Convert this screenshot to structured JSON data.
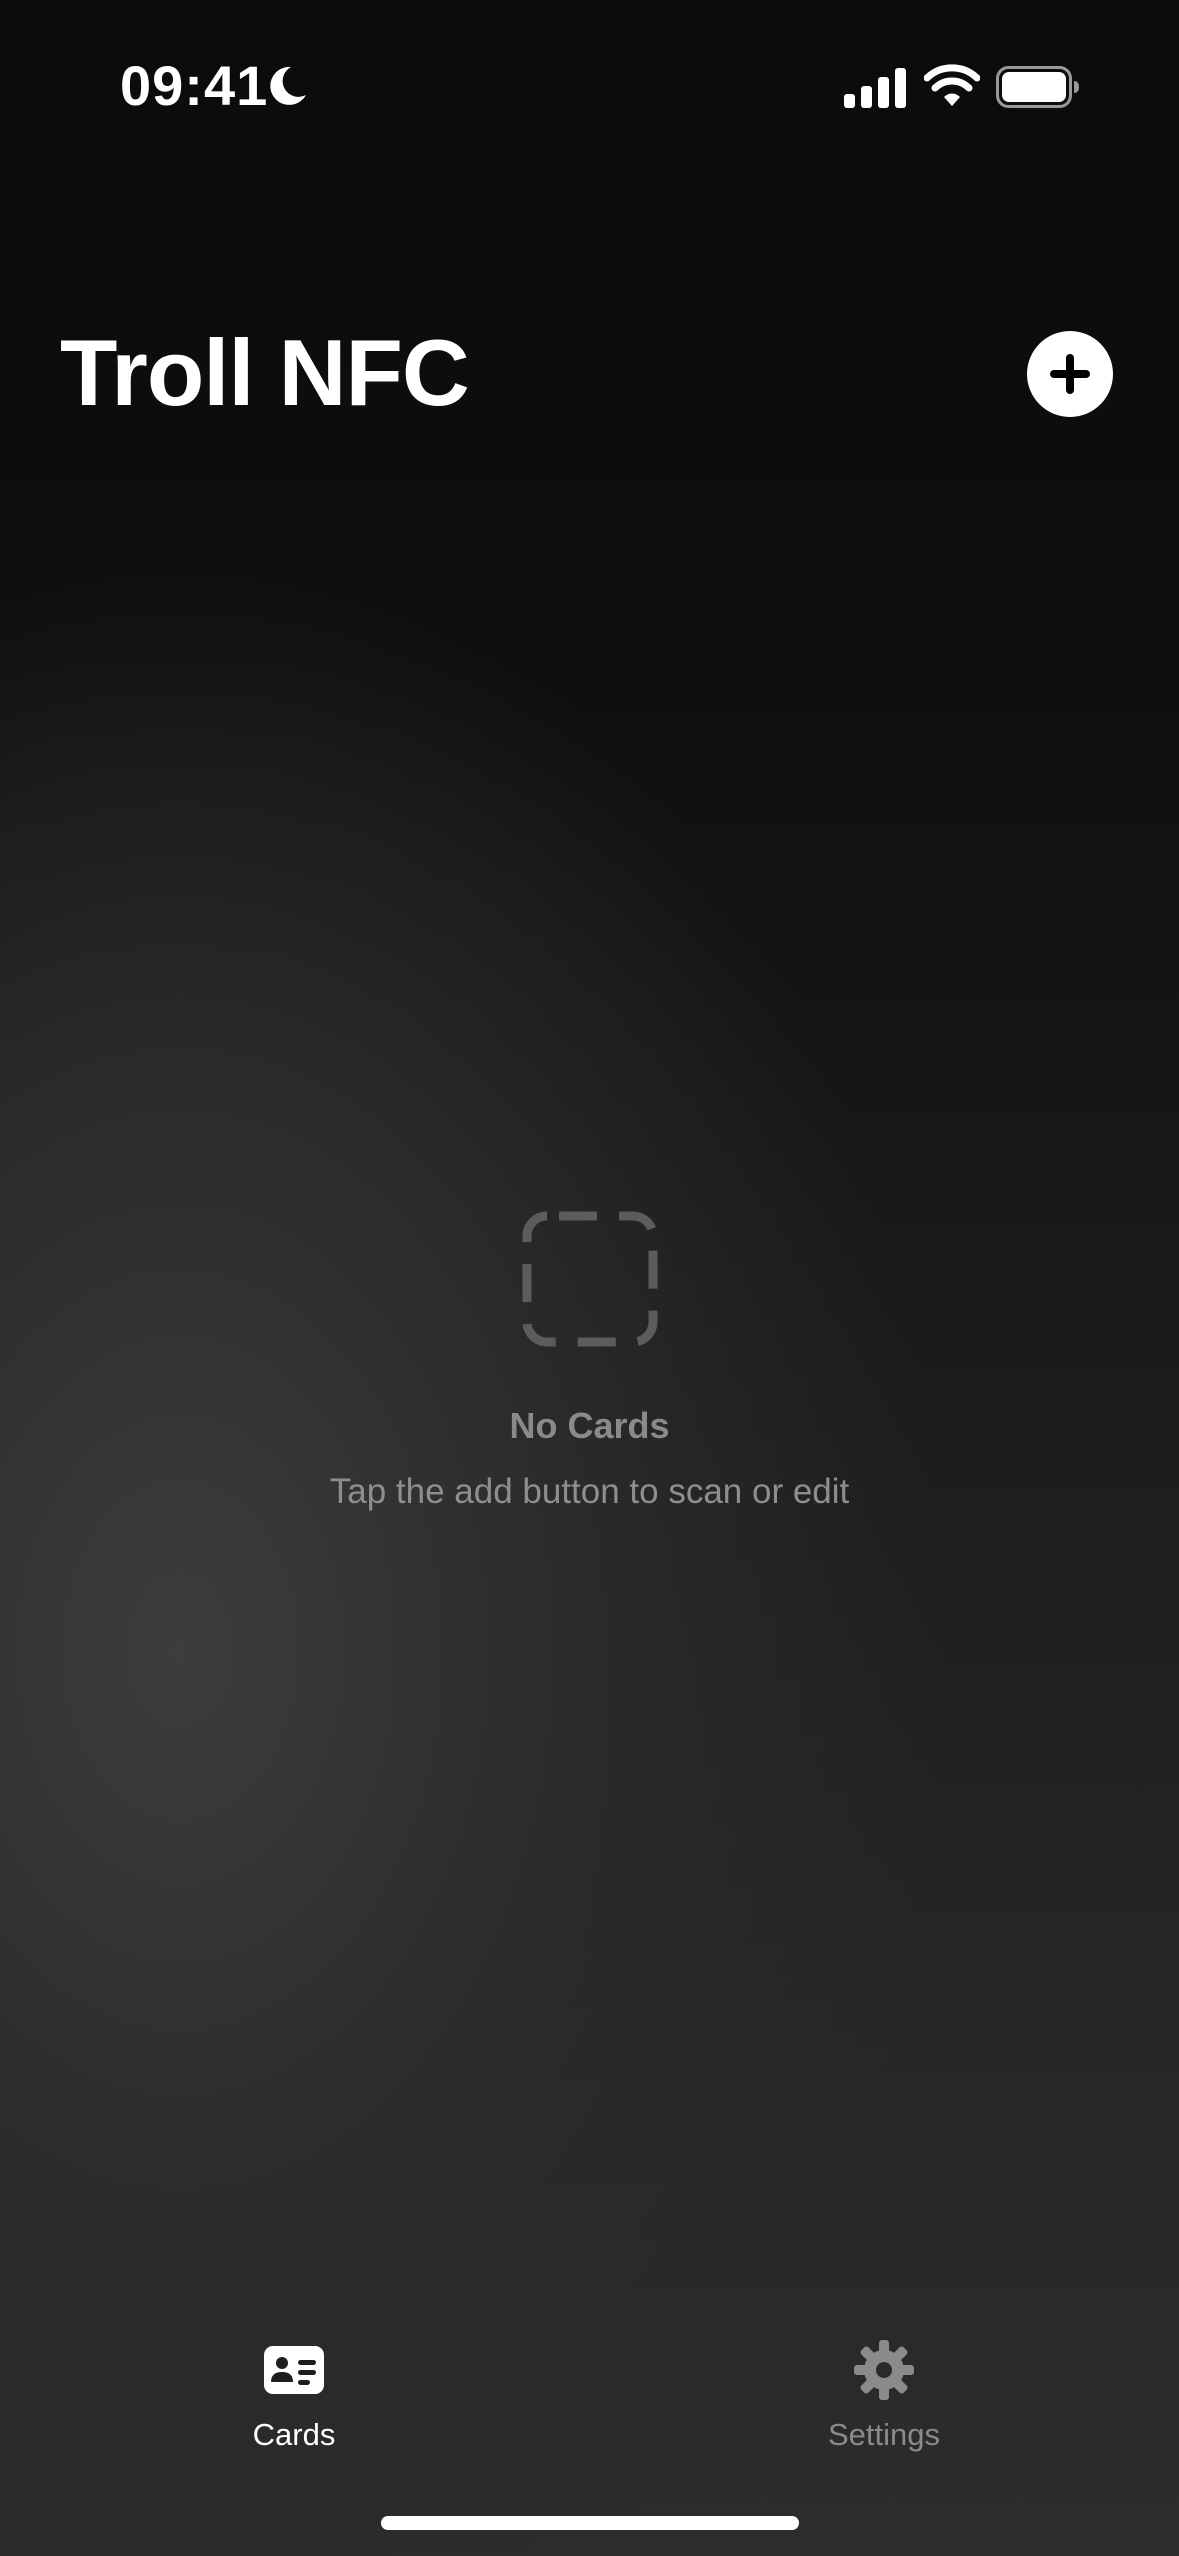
{
  "status_bar": {
    "time": "09:41",
    "icons": [
      "moon-icon",
      "cellular-signal-icon",
      "wifi-icon",
      "battery-icon"
    ]
  },
  "header": {
    "title": "Troll NFC",
    "add_button_icon": "plus-icon"
  },
  "empty_state": {
    "icon": "dashed-square-icon",
    "title": "No Cards",
    "subtitle": "Tap the add button to scan or edit"
  },
  "tab_bar": {
    "tabs": [
      {
        "label": "Cards",
        "icon": "person-card-icon",
        "selected": true
      },
      {
        "label": "Settings",
        "icon": "gear-icon",
        "selected": false
      }
    ]
  },
  "colors": {
    "accent": "#ffffff",
    "secondary_text": "#8a8a8a",
    "background_dark": "#0b0b0b",
    "background_light": "#3d3d3d"
  }
}
